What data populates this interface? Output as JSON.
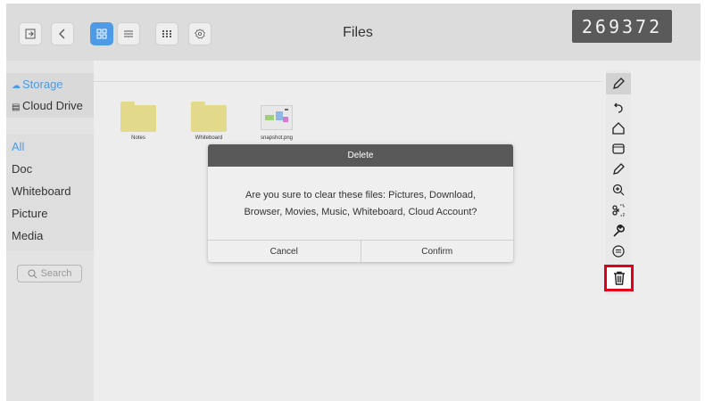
{
  "header": {
    "title": "Files",
    "counter": "269372",
    "buttons": [
      {
        "icon": "exit-icon"
      },
      {
        "icon": "back-chevron-icon"
      },
      {
        "icon": "grid-view-icon",
        "active": true
      },
      {
        "icon": "list-view-icon"
      },
      {
        "icon": "apps-icon"
      },
      {
        "icon": "settings-icon"
      }
    ]
  },
  "sidebar": {
    "storage": "Storage",
    "cloud": "Cloud Drive",
    "categories": [
      "All",
      "Doc",
      "Whiteboard",
      "Picture",
      "Media"
    ],
    "selected": "All",
    "search_placeholder": "Search"
  },
  "files": [
    {
      "name": "Notes",
      "type": "folder"
    },
    {
      "name": "Whiteboard",
      "type": "folder"
    },
    {
      "name": "snapshot.png",
      "type": "image"
    }
  ],
  "dialog": {
    "title": "Delete",
    "message": "Are you sure to clear these files: Pictures, Download, Browser, Movies, Music, Whiteboard, Cloud Account?",
    "cancel": "Cancel",
    "confirm": "Confirm"
  },
  "toolbar": {
    "tools": [
      "pencil-icon",
      "undo-icon",
      "home-icon",
      "window-icon",
      "pen-icon",
      "zoom-in-icon",
      "screenshot-icon",
      "wrench-icon",
      "comment-icon",
      "trash-icon"
    ],
    "highlighted": "trash-icon",
    "highlight_color": "#e0001b"
  },
  "colors": {
    "accent": "#4d9be6"
  }
}
